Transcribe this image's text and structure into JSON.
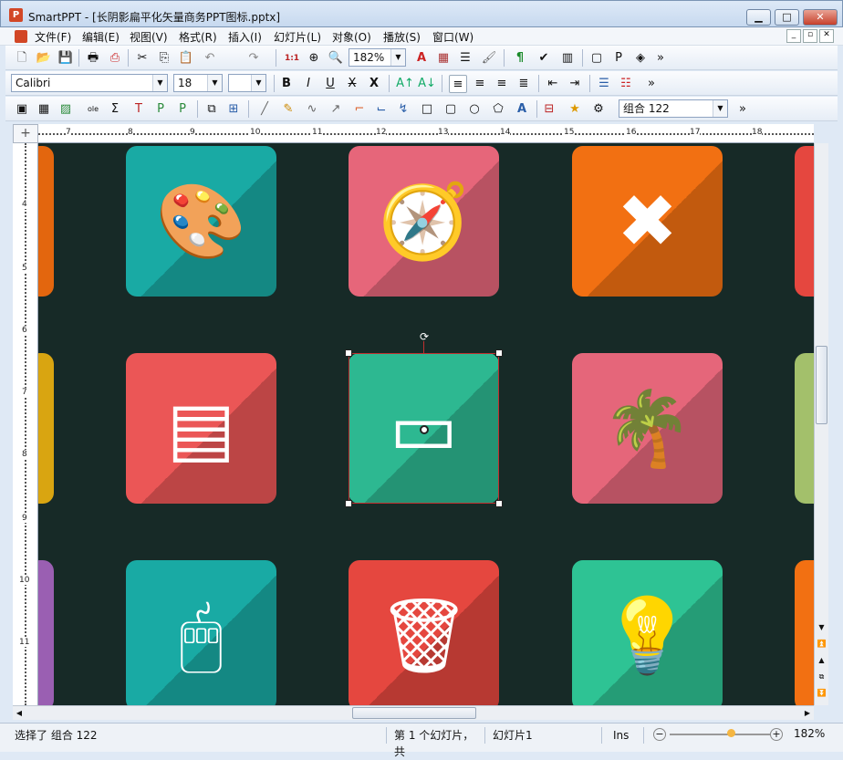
{
  "window": {
    "title": "SmartPPT - [长阴影扁平化矢量商务PPT图标.pptx]",
    "app_icon_letter": "P",
    "min_label": "▁",
    "max_label": "□",
    "close_label": "✕"
  },
  "menus": [
    "文件(F)",
    "编辑(E)",
    "视图(V)",
    "格式(R)",
    "插入(I)",
    "幻灯片(L)",
    "对象(O)",
    "播放(S)",
    "窗口(W)"
  ],
  "toolbar1": {
    "zoom": "182%"
  },
  "toolbar2": {
    "font": "Calibri",
    "size": "18"
  },
  "toolbar3": {
    "object_name": "组合 122"
  },
  "more_glyph": "»",
  "ruler": {
    "h_numbers": [
      "7",
      "8",
      "9",
      "10",
      "11",
      "12",
      "13",
      "14",
      "15",
      "16",
      "17",
      "18"
    ],
    "v_numbers": [
      "4",
      "5",
      "6",
      "7",
      "8",
      "9",
      "10",
      "11"
    ]
  },
  "tiles": [
    {
      "name": "palette-icon",
      "color": "#19aaa4",
      "glyph": "🎨"
    },
    {
      "name": "compass-icon",
      "color": "#e6667a",
      "glyph": "🧭"
    },
    {
      "name": "close-x-icon",
      "color": "#f27012",
      "glyph": "✖"
    },
    {
      "name": "notebook-icon",
      "color": "#eb5656",
      "glyph": "▤"
    },
    {
      "name": "battery-icon",
      "color": "#2db891",
      "glyph": "▭"
    },
    {
      "name": "palm-tree-icon",
      "color": "#e5667a",
      "glyph": "🌴"
    },
    {
      "name": "mouse-icon",
      "color": "#19aaa4",
      "glyph": "🖱"
    },
    {
      "name": "trash-icon",
      "color": "#e5473f",
      "glyph": "🗑"
    },
    {
      "name": "lightbulb-icon",
      "color": "#2ec394",
      "glyph": "💡"
    }
  ],
  "rotate_handle_glyph": "⟳",
  "status": {
    "selection": "选择了 组合 122",
    "slide_pos": "第 1 个幻灯片，共",
    "slide_name": "幻灯片1",
    "mode": "Ins",
    "zoom": "182%",
    "zoom_minus": "−",
    "zoom_plus": "+"
  }
}
